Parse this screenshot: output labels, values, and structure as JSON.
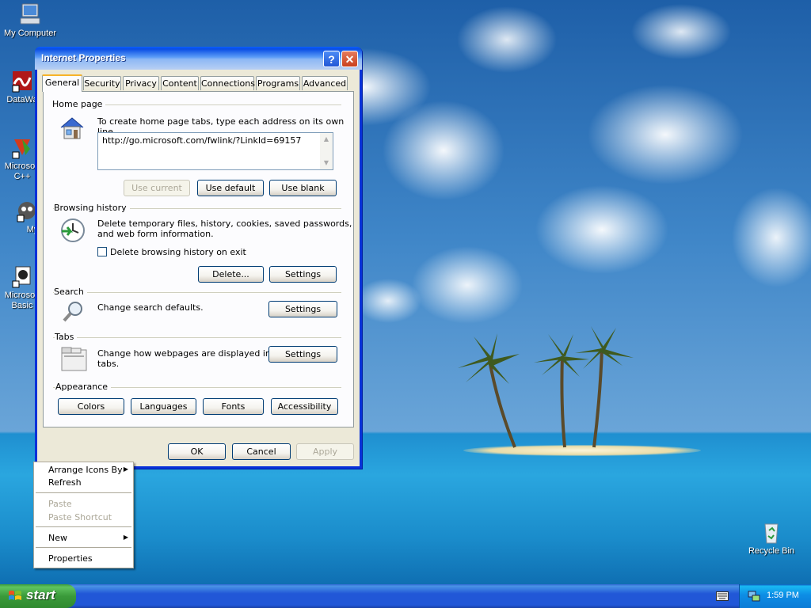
{
  "desktop": {
    "icons": [
      {
        "label": "My Computer",
        "icon": "computer-icon"
      },
      {
        "label": "DataWa",
        "icon": "datawave-icon"
      },
      {
        "label": "Microsoft C++",
        "icon": "visual-cpp-icon"
      },
      {
        "label": "Myp",
        "icon": "app-icon"
      },
      {
        "label": "Microsoft Basic",
        "icon": "visual-basic-icon"
      },
      {
        "label": "Recycle Bin",
        "icon": "recycle-bin-icon"
      }
    ]
  },
  "dialog": {
    "title": "Internet Properties",
    "help_glyph": "?",
    "close_glyph": "✕",
    "tabs": [
      "General",
      "Security",
      "Privacy",
      "Content",
      "Connections",
      "Programs",
      "Advanced"
    ],
    "active_tab": "General",
    "home_page": {
      "section": "Home page",
      "description": "To create home page tabs, type each address on its own line.",
      "url": "http://go.microsoft.com/fwlink/?LinkId=69157",
      "use_current": "Use current",
      "use_default": "Use default",
      "use_blank": "Use blank"
    },
    "browsing_history": {
      "section": "Browsing history",
      "description_1": "Delete temporary files, history, cookies, saved passwords,",
      "description_2": "and web form information.",
      "checkbox_label": "Delete browsing history on exit",
      "checkbox_checked": false,
      "delete": "Delete...",
      "settings": "Settings"
    },
    "search": {
      "section": "Search",
      "description": "Change search defaults.",
      "settings": "Settings"
    },
    "tabs_section": {
      "section": "Tabs",
      "description_1": "Change how webpages are displayed in",
      "description_2": "tabs.",
      "settings": "Settings"
    },
    "appearance": {
      "section": "Appearance",
      "colors": "Colors",
      "languages": "Languages",
      "fonts": "Fonts",
      "accessibility": "Accessibility"
    },
    "footer": {
      "ok": "OK",
      "cancel": "Cancel",
      "apply": "Apply"
    }
  },
  "context_menu": {
    "arrange": "Arrange Icons By",
    "refresh": "Refresh",
    "paste": "Paste",
    "paste_shortcut": "Paste Shortcut",
    "new": "New",
    "properties": "Properties",
    "submenu_arrow": "▶"
  },
  "taskbar": {
    "start_label": "start",
    "clock": "1:59 PM",
    "tray_icons": [
      "keyboard-icon",
      "network-icon"
    ]
  },
  "colors": {
    "titlebar": "#0a4ee4",
    "dialog_face": "#ece9d8",
    "taskbar": "#2157d7",
    "start_button": "#3a9a3a"
  }
}
